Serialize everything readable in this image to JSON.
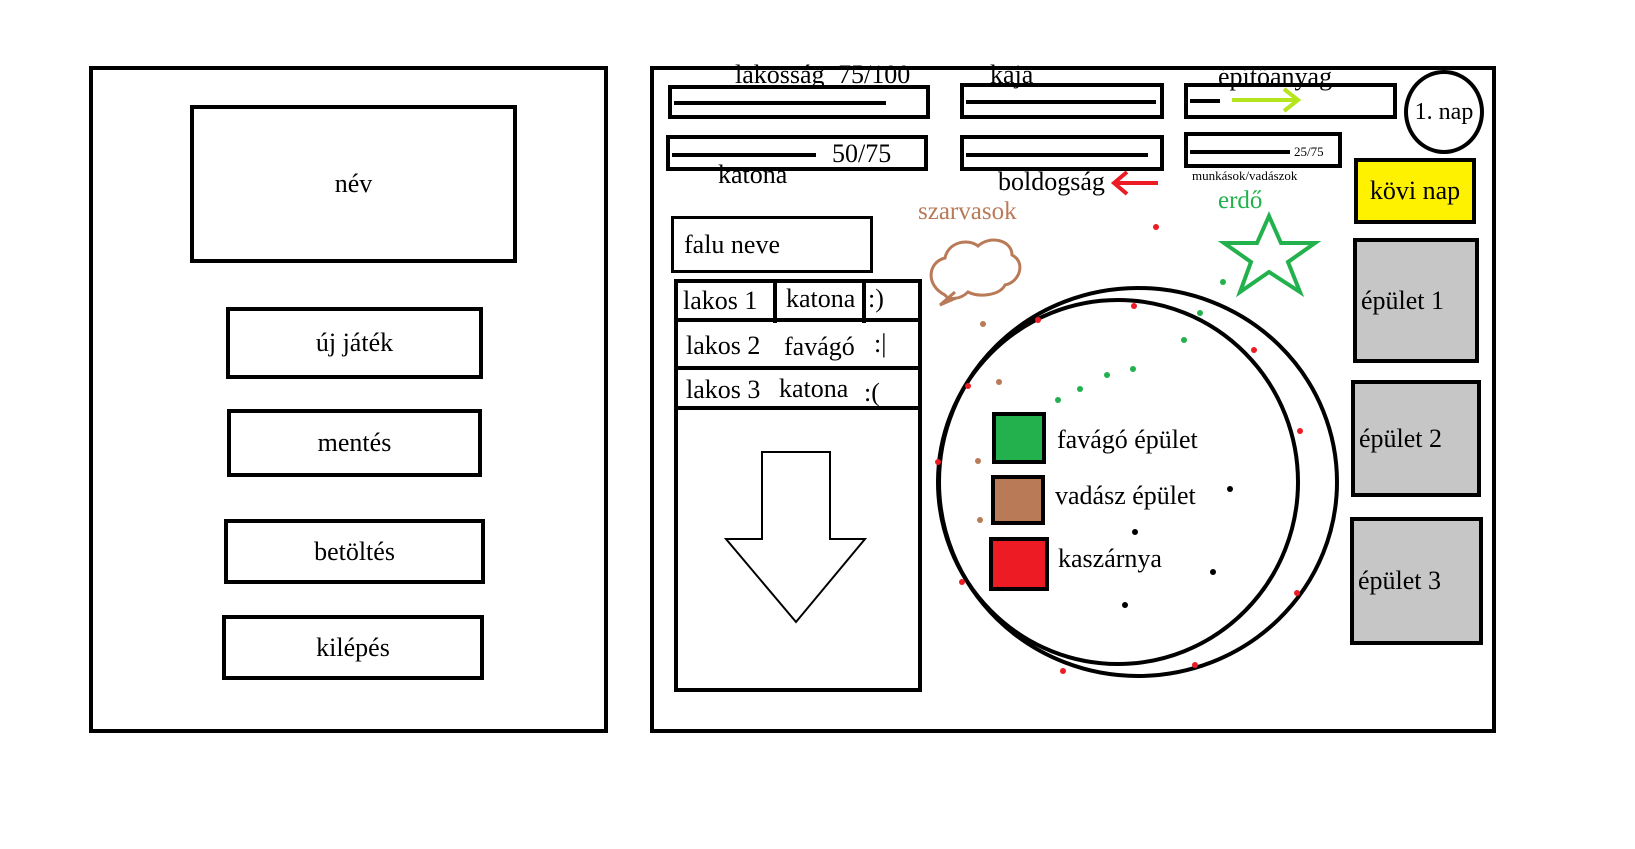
{
  "menu": {
    "name_field": "név",
    "new_game": "új játék",
    "save": "mentés",
    "load": "betöltés",
    "quit": "kilépés"
  },
  "hud": {
    "population_label": "lakosság",
    "population_value": "75/100",
    "population_fraction": 0.75,
    "food_label": "kaja",
    "food_fraction": 0.95,
    "materials_label": "építőanyag",
    "materials_fraction": 0.15,
    "soldiers_label": "katona",
    "soldiers_value": "50/75",
    "soldiers_fraction": 0.67,
    "happiness_label": "boldogság",
    "happiness_fraction": 0.97,
    "workers_label": "munkások/vadászok",
    "workers_value": "25/75",
    "day_label": "1. nap",
    "next_day": "kövi nap"
  },
  "village": {
    "name_field": "falu neve",
    "residents": [
      {
        "name": "lakos 1",
        "role": "katona",
        "mood": ":)"
      },
      {
        "name": "lakos 2",
        "role": "favágó",
        "mood": ":|"
      },
      {
        "name": "lakos 3",
        "role": "katona",
        "mood": ":("
      }
    ]
  },
  "buildings": [
    "épület 1",
    "épület 2",
    "épület 3"
  ],
  "map": {
    "deer_label": "szarvasok",
    "forest_label": "erdő",
    "legend": [
      {
        "label": "favágó épület",
        "color": "#22b14c"
      },
      {
        "label": "vadász épület",
        "color": "#b97a57"
      },
      {
        "label": "kaszárnya",
        "color": "#ed1c24"
      }
    ]
  },
  "colors": {
    "green": "#22b14c",
    "brown": "#b97a57",
    "red": "#ed1c24",
    "yellow": "#fff200",
    "grey": "#c6c6c6",
    "lime": "#b5e61d"
  }
}
